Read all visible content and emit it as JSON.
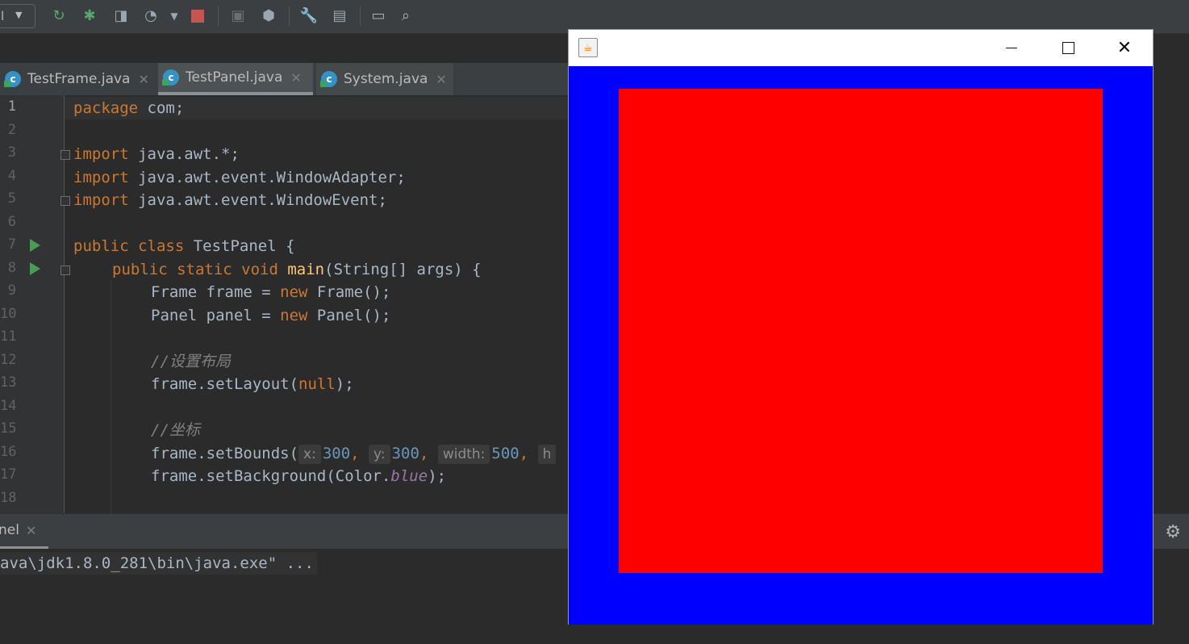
{
  "toolbar": {
    "run_config_label": "l",
    "icons": [
      "rerun-icon",
      "debug-icon",
      "coverage-icon",
      "profile-icon",
      "stop-icon",
      "build-icon",
      "deploy-icon",
      "wrench-icon",
      "project-structure-icon",
      "terminal-icon",
      "search-icon"
    ]
  },
  "tabs": [
    {
      "label": "TestFrame.java",
      "active": false,
      "icon": "c"
    },
    {
      "label": "TestPanel.java",
      "active": true,
      "icon": "c"
    },
    {
      "label": "System.java",
      "active": false,
      "icon": "c"
    }
  ],
  "editor": {
    "line_numbers": [
      "1",
      "2",
      "3",
      "4",
      "5",
      "6",
      "7",
      "8",
      "9",
      "10",
      "11",
      "12",
      "13",
      "14",
      "15",
      "16",
      "17",
      "18"
    ],
    "current_line": "1",
    "code": {
      "l1_kw": "package",
      "l1_rest": " com;",
      "l3_kw": "import",
      "l3_rest": " java.awt.*;",
      "l4_kw": "import",
      "l4_rest": " java.awt.event.WindowAdapter;",
      "l5_kw": "import",
      "l5_rest": " java.awt.event.WindowEvent;",
      "l7_kw": "public class",
      "l7_rest": " TestPanel {",
      "l8_kw": "public static void",
      "l8_fn": "main",
      "l8_rest": "(String[] args) {",
      "l9_a": "Frame frame = ",
      "l9_kw": "new",
      "l9_b": " Frame();",
      "l10_a": "Panel panel = ",
      "l10_kw": "new",
      "l10_b": " Panel();",
      "l12_comment": "//设置布局",
      "l13_a": "frame.setLayout(",
      "l13_kw": "null",
      "l13_b": ");",
      "l15_comment": "//坐标",
      "l16_a": "frame.setBounds(",
      "l16_hint_x": "x:",
      "l16_x": "300",
      "l16_hint_y": "y:",
      "l16_y": "300",
      "l16_hint_w": "width:",
      "l16_w": "500",
      "l16_hint_h": "h",
      "l17_a": "frame.setBackground(Color.",
      "l17_field": "blue",
      "l17_b": ");"
    }
  },
  "run_panel": {
    "tab_label": "nel",
    "console_line": "ava\\jdk1.8.0_281\\bin\\java.exe\" ..."
  },
  "awt_window": {
    "frame_background": "#0000ff",
    "panel_background": "#ff0000",
    "title": ""
  }
}
